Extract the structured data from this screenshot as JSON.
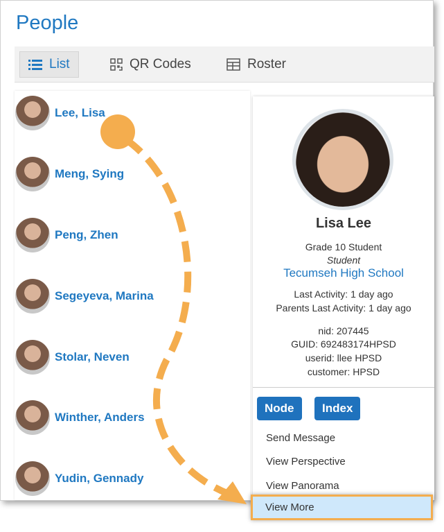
{
  "title": "People",
  "tabs": [
    {
      "label": "List",
      "icon": "list-icon"
    },
    {
      "label": "QR Codes",
      "icon": "qr-icon"
    },
    {
      "label": "Roster",
      "icon": "table-icon"
    }
  ],
  "people": [
    "Lee, Lisa",
    "Meng, Sying",
    "Peng, Zhen",
    "Segeyeva, Marina",
    "Stolar, Neven",
    "Winther, Anders",
    "Yudin, Gennady"
  ],
  "profile": {
    "name": "Lisa Lee",
    "grade": "Grade 10 Student",
    "role": "Student",
    "school": "Tecumseh High School",
    "last_activity": "Last Activity: 1 day ago",
    "parents_activity": "Parents Last Activity: 1 day ago",
    "nid": "nid: 207445",
    "guid": "GUID: 692483174HPSD",
    "userid": "userid: llee HPSD",
    "customer": "customer: HPSD"
  },
  "buttons": {
    "node": "Node",
    "index": "Index"
  },
  "menu": [
    "Send Message",
    "View Perspective",
    "View Panorama",
    "View More"
  ],
  "colors": {
    "accent": "#1f78c1",
    "highlight": "#f4ad4e"
  }
}
